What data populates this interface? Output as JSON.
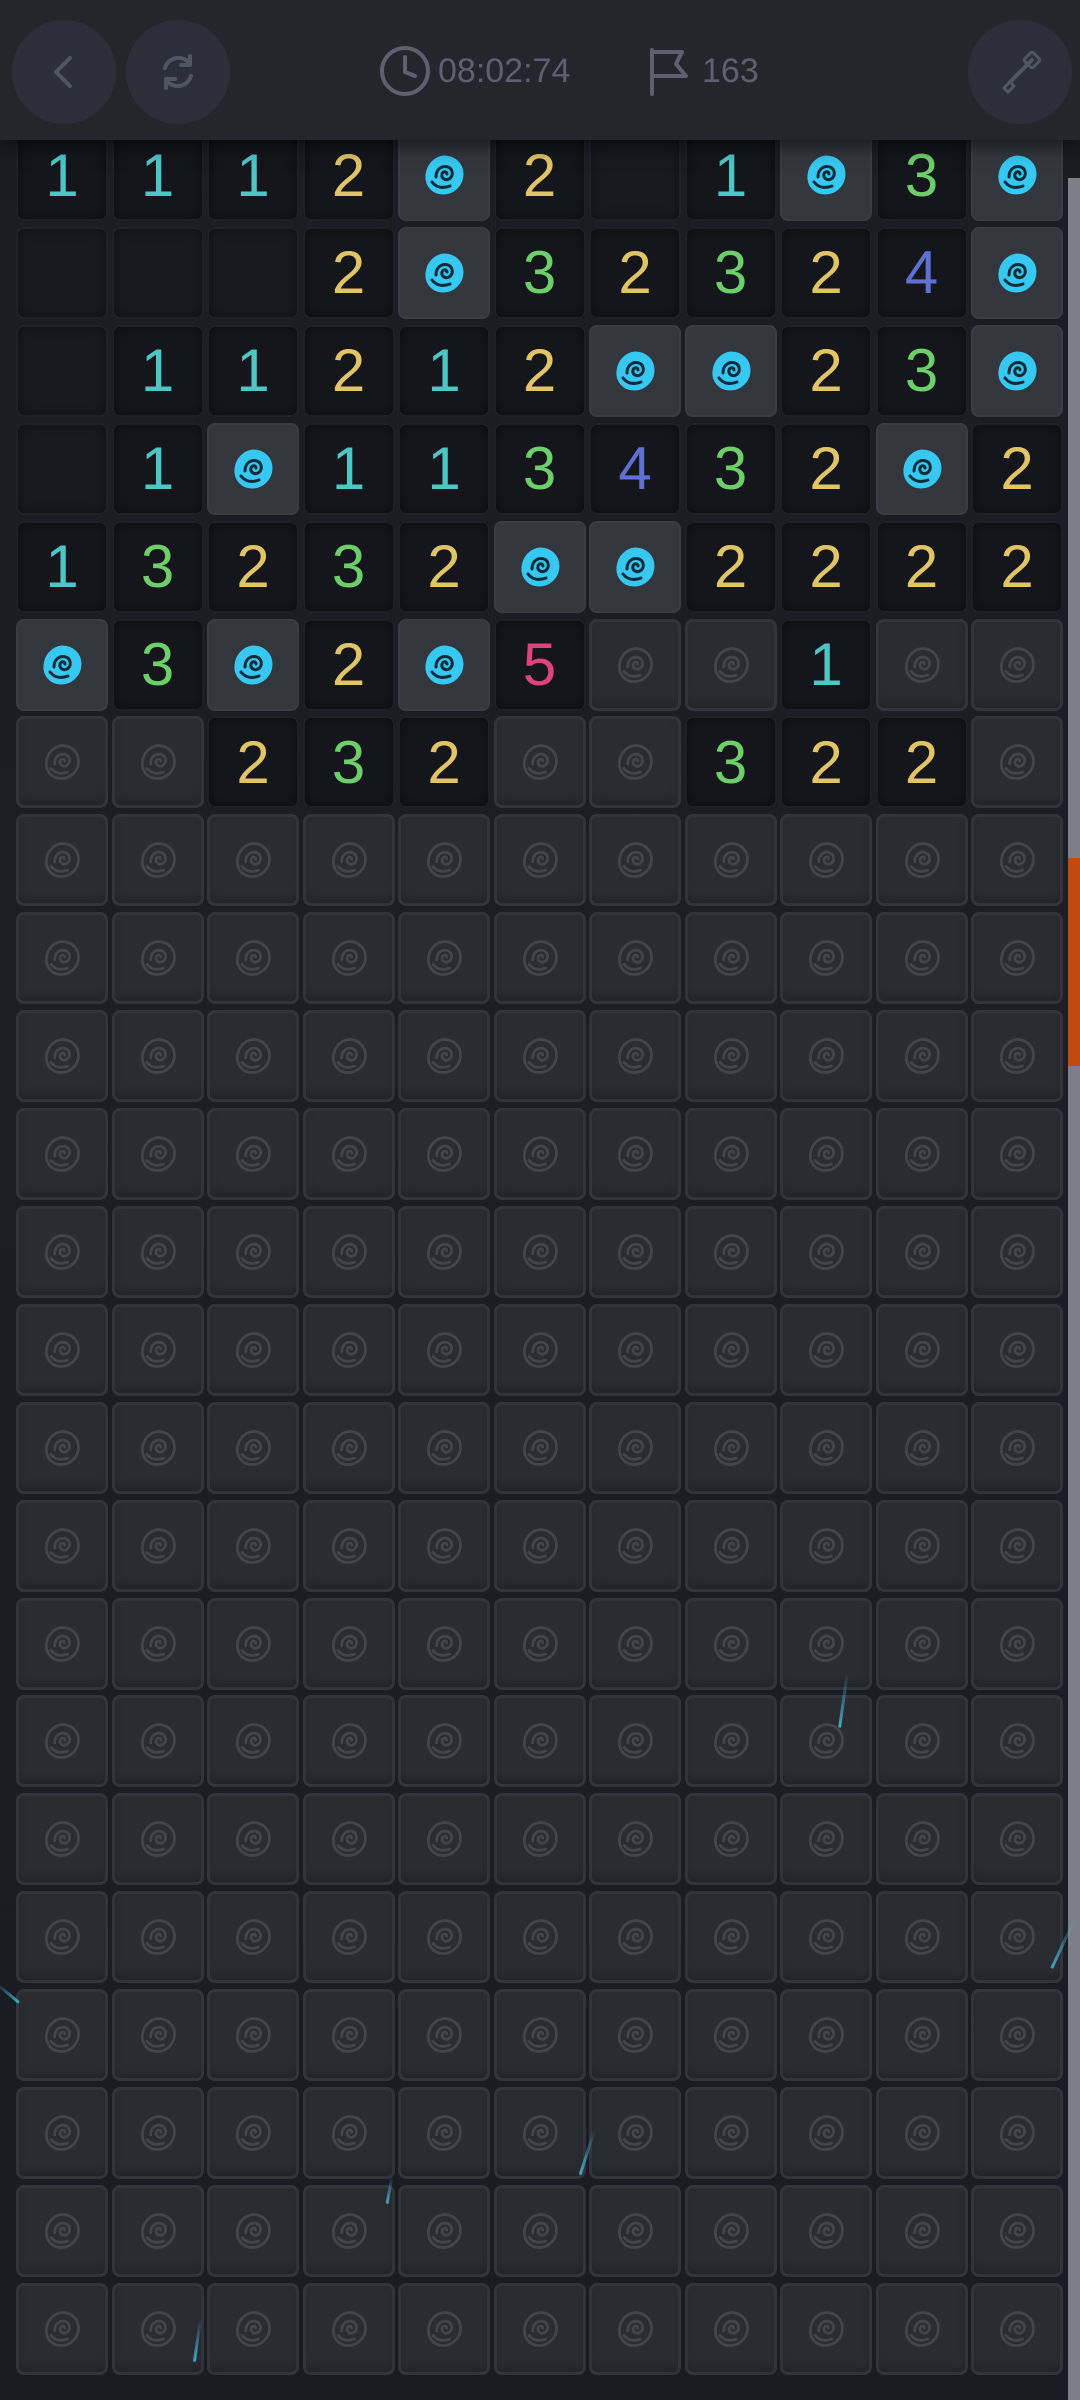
{
  "header": {
    "back_icon": "chevron-left-icon",
    "restart_icon": "refresh-icon",
    "timer": "08:02:74",
    "timer_icon": "clock-icon",
    "flags": "163",
    "flags_icon": "flag-icon",
    "tool_icon": "shovel-icon"
  },
  "board": {
    "columns": 11,
    "visible_rows": 23,
    "first_row_partial": true,
    "mine_icon": "rose-icon",
    "hidden_icon": "rose-outline-icon",
    "rows": [
      [
        "1",
        "1",
        "1",
        "2",
        "F",
        "2",
        "",
        "1",
        "F",
        "3",
        "F"
      ],
      [
        "",
        "",
        "",
        "2",
        "F",
        "3",
        "2",
        "3",
        "2",
        "4",
        "F"
      ],
      [
        "",
        "1",
        "1",
        "2",
        "1",
        "2",
        "F",
        "F",
        "2",
        "3",
        "F"
      ],
      [
        "",
        "1",
        "F",
        "1",
        "1",
        "3",
        "4",
        "3",
        "2",
        "F",
        "2"
      ],
      [
        "1",
        "3",
        "2",
        "3",
        "2",
        "F",
        "F",
        "2",
        "2",
        "2",
        "2"
      ],
      [
        "F",
        "3",
        "F",
        "2",
        "F",
        "5",
        "H",
        "H",
        "1",
        "H",
        "H"
      ],
      [
        "H",
        "H",
        "2",
        "3",
        "2",
        "H",
        "H",
        "3",
        "2",
        "2",
        "H"
      ]
    ],
    "number_colors": {
      "1": "#4fc6c6",
      "2": "#e0c466",
      "3": "#6ccf6a",
      "4": "#5f6fd2",
      "5": "#e0427a"
    },
    "flag_color": "#36c8f0"
  },
  "scrollbar": {
    "thumb_color": "#c24a0f",
    "track_color": "#7d7f88"
  }
}
